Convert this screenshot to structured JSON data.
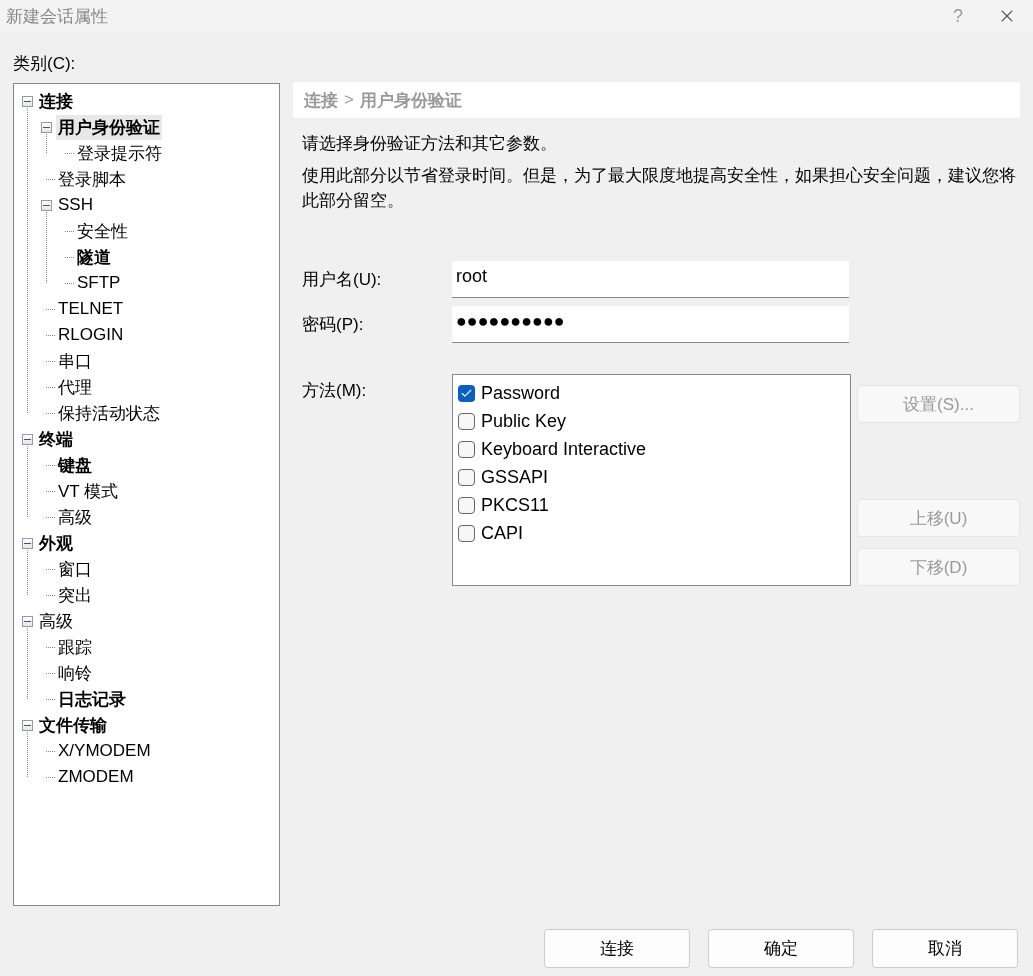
{
  "window": {
    "title": "新建会话属性",
    "help": "?"
  },
  "category_label": "类别(C):",
  "tree": [
    {
      "label": "连接",
      "bold": true,
      "selected": false,
      "expanded": true,
      "children": [
        {
          "label": "用户身份验证",
          "bold": true,
          "selected": true,
          "expanded": true,
          "children": [
            {
              "label": "登录提示符",
              "bold": false,
              "selected": false
            }
          ]
        },
        {
          "label": "登录脚本",
          "bold": false,
          "selected": false
        },
        {
          "label": "SSH",
          "bold": false,
          "selected": false,
          "expanded": true,
          "children": [
            {
              "label": "安全性",
              "bold": false,
              "selected": false
            },
            {
              "label": "隧道",
              "bold": true,
              "selected": false
            },
            {
              "label": "SFTP",
              "bold": false,
              "selected": false
            }
          ]
        },
        {
          "label": "TELNET",
          "bold": false,
          "selected": false
        },
        {
          "label": "RLOGIN",
          "bold": false,
          "selected": false
        },
        {
          "label": "串口",
          "bold": false,
          "selected": false
        },
        {
          "label": "代理",
          "bold": false,
          "selected": false
        },
        {
          "label": "保持活动状态",
          "bold": false,
          "selected": false
        }
      ]
    },
    {
      "label": "终端",
      "bold": true,
      "selected": false,
      "expanded": true,
      "children": [
        {
          "label": "键盘",
          "bold": true,
          "selected": false
        },
        {
          "label": "VT 模式",
          "bold": false,
          "selected": false
        },
        {
          "label": "高级",
          "bold": false,
          "selected": false
        }
      ]
    },
    {
      "label": "外观",
      "bold": true,
      "selected": false,
      "expanded": true,
      "children": [
        {
          "label": "窗口",
          "bold": false,
          "selected": false
        },
        {
          "label": "突出",
          "bold": false,
          "selected": false
        }
      ]
    },
    {
      "label": "高级",
      "bold": false,
      "selected": false,
      "expanded": true,
      "children": [
        {
          "label": "跟踪",
          "bold": false,
          "selected": false
        },
        {
          "label": "响铃",
          "bold": false,
          "selected": false
        },
        {
          "label": "日志记录",
          "bold": true,
          "selected": false
        }
      ]
    },
    {
      "label": "文件传输",
      "bold": true,
      "selected": false,
      "expanded": true,
      "children": [
        {
          "label": "X/YMODEM",
          "bold": false,
          "selected": false
        },
        {
          "label": "ZMODEM",
          "bold": false,
          "selected": false
        }
      ]
    }
  ],
  "breadcrumb": [
    "连接",
    ">",
    "用户身份验证"
  ],
  "intro": "请选择身份验证方法和其它参数。",
  "description": "使用此部分以节省登录时间。但是，为了最大限度地提高安全性，如果担心安全问题，建议您将此部分留空。",
  "fields": [
    {
      "label": "用户名(U):",
      "value": "root"
    },
    {
      "label": "密码(P):",
      "value": "●●●●●●●●●●"
    }
  ],
  "method_label": "方法(M):",
  "methods": [
    {
      "label": "Password",
      "checked": true
    },
    {
      "label": "Public Key",
      "checked": false
    },
    {
      "label": "Keyboard Interactive",
      "checked": false
    },
    {
      "label": "GSSAPI",
      "checked": false
    },
    {
      "label": "PKCS11",
      "checked": false
    },
    {
      "label": "CAPI",
      "checked": false
    }
  ],
  "side_buttons": [
    {
      "label": "设置(S)...",
      "disabled": true
    },
    {
      "label": "上移(U)",
      "disabled": true
    },
    {
      "label": "下移(D)",
      "disabled": true
    }
  ],
  "footer_buttons": [
    {
      "label": "连接",
      "disabled": false
    },
    {
      "label": "确定",
      "disabled": false
    },
    {
      "label": "取消",
      "disabled": false
    }
  ]
}
